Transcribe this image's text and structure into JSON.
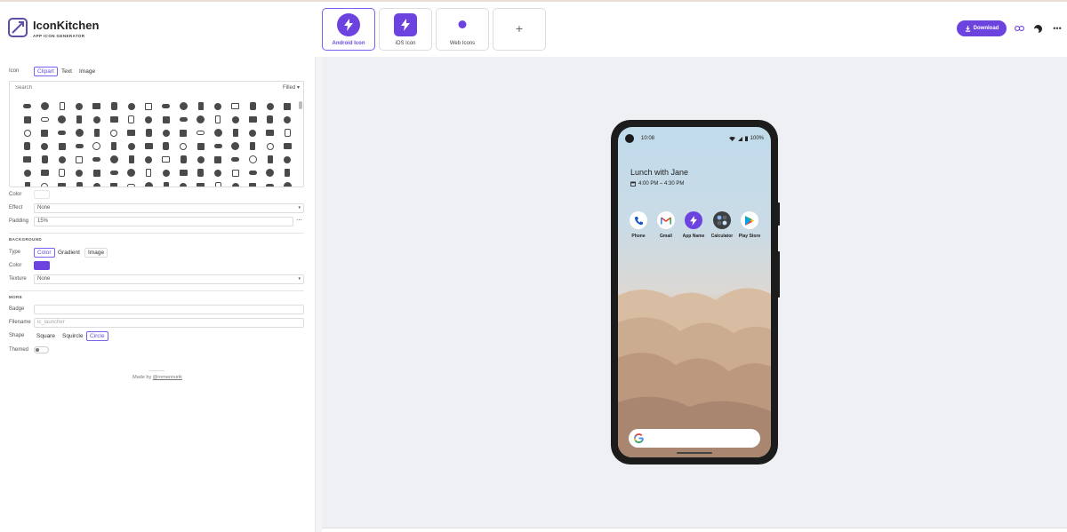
{
  "brand": {
    "title": "IconKitchen",
    "subtitle": "APP ICON GENERATOR"
  },
  "targets": [
    {
      "label": "Android Icon",
      "active": true
    },
    {
      "label": "iOS Icon",
      "active": false
    },
    {
      "label": "Web Icons",
      "active": false
    }
  ],
  "header": {
    "download_label": "Download"
  },
  "icon_section": {
    "label": "Icon",
    "sources": [
      "Clipart",
      "Text",
      "Image"
    ],
    "selected_source": "Clipart",
    "search_placeholder": "Search",
    "filter": "Filled",
    "color_label": "Color",
    "effect_label": "Effect",
    "effect_value": "None",
    "padding_label": "Padding",
    "padding_value": "15%"
  },
  "background": {
    "heading": "BACKGROUND",
    "type_label": "Type",
    "types": [
      "Color",
      "Gradient",
      "Image"
    ],
    "selected_type": "Color",
    "color_label": "Color",
    "color": "#6d43e0",
    "texture_label": "Texture",
    "texture_value": "None"
  },
  "more": {
    "heading": "MORE",
    "badge_label": "Badge",
    "filename_label": "Filename",
    "filename_placeholder": "ic_launcher",
    "shape_label": "Shape",
    "shapes": [
      "Square",
      "Squircle",
      "Circle"
    ],
    "selected_shape": "Circle",
    "themed_label": "Themed"
  },
  "footer": {
    "prefix": "Made by ",
    "author": "@romannurik"
  },
  "preview": {
    "time": "10:08",
    "battery": "100%",
    "event_title": "Lunch with Jane",
    "event_time": "4:00 PM – 4:30 PM",
    "apps": [
      "Phone",
      "Gmail",
      "App Name",
      "Calculator",
      "Play Store"
    ]
  },
  "colors": {
    "accent": "#6d43e0",
    "accent_border": "#7b5ff0",
    "preview_bg": "#eef0f4"
  }
}
